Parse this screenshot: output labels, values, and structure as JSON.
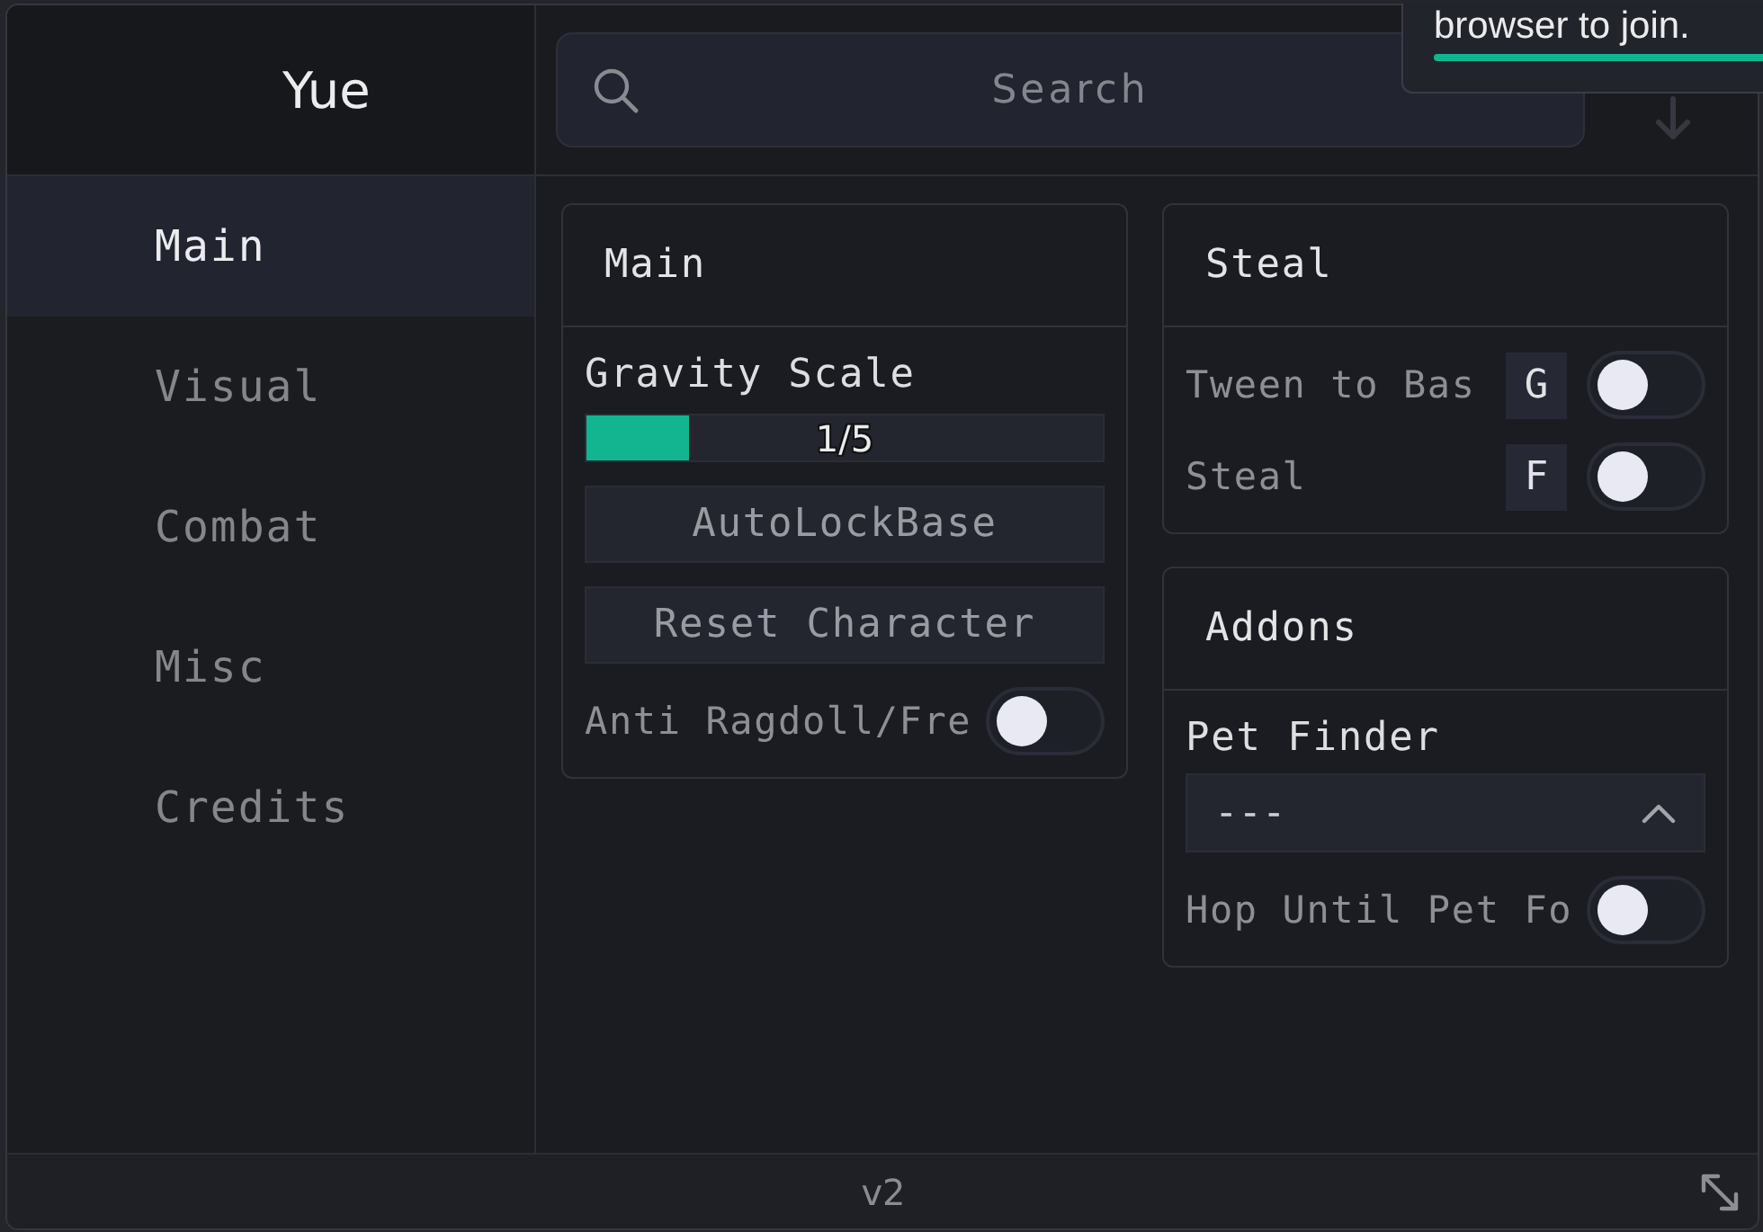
{
  "window": {
    "title": "Yue",
    "version": "v2"
  },
  "search": {
    "placeholder": "Search"
  },
  "notification": {
    "text": "browser to join."
  },
  "sidebar": {
    "items": [
      {
        "label": "Main",
        "selected": true
      },
      {
        "label": "Visual",
        "selected": false
      },
      {
        "label": "Combat",
        "selected": false
      },
      {
        "label": "Misc",
        "selected": false
      },
      {
        "label": "Credits",
        "selected": false
      }
    ]
  },
  "columns": [
    {
      "sections": [
        {
          "title": "Main",
          "controls": [
            {
              "kind": "slider",
              "label": "Gravity Scale",
              "level": 0.2,
              "reading": "1/5"
            },
            {
              "kind": "button",
              "label": "AutoLockBase"
            },
            {
              "kind": "button",
              "label": "Reset Character"
            },
            {
              "kind": "toggle",
              "label": "Anti Ragdoll/Fre",
              "on": false
            }
          ]
        }
      ]
    },
    {
      "sections": [
        {
          "title": "Steal",
          "controls": [
            {
              "kind": "toggle",
              "label": "Tween to Bas",
              "keybind": "G",
              "on": false
            },
            {
              "kind": "toggle",
              "label": "Steal",
              "keybind": "F",
              "on": false
            }
          ]
        },
        {
          "title": "Addons",
          "controls": [
            {
              "kind": "dropdown",
              "label": "Pet Finder",
              "value": "---"
            },
            {
              "kind": "toggle",
              "label": "Hop Until Pet Fo",
              "on": false
            }
          ]
        }
      ]
    }
  ]
}
